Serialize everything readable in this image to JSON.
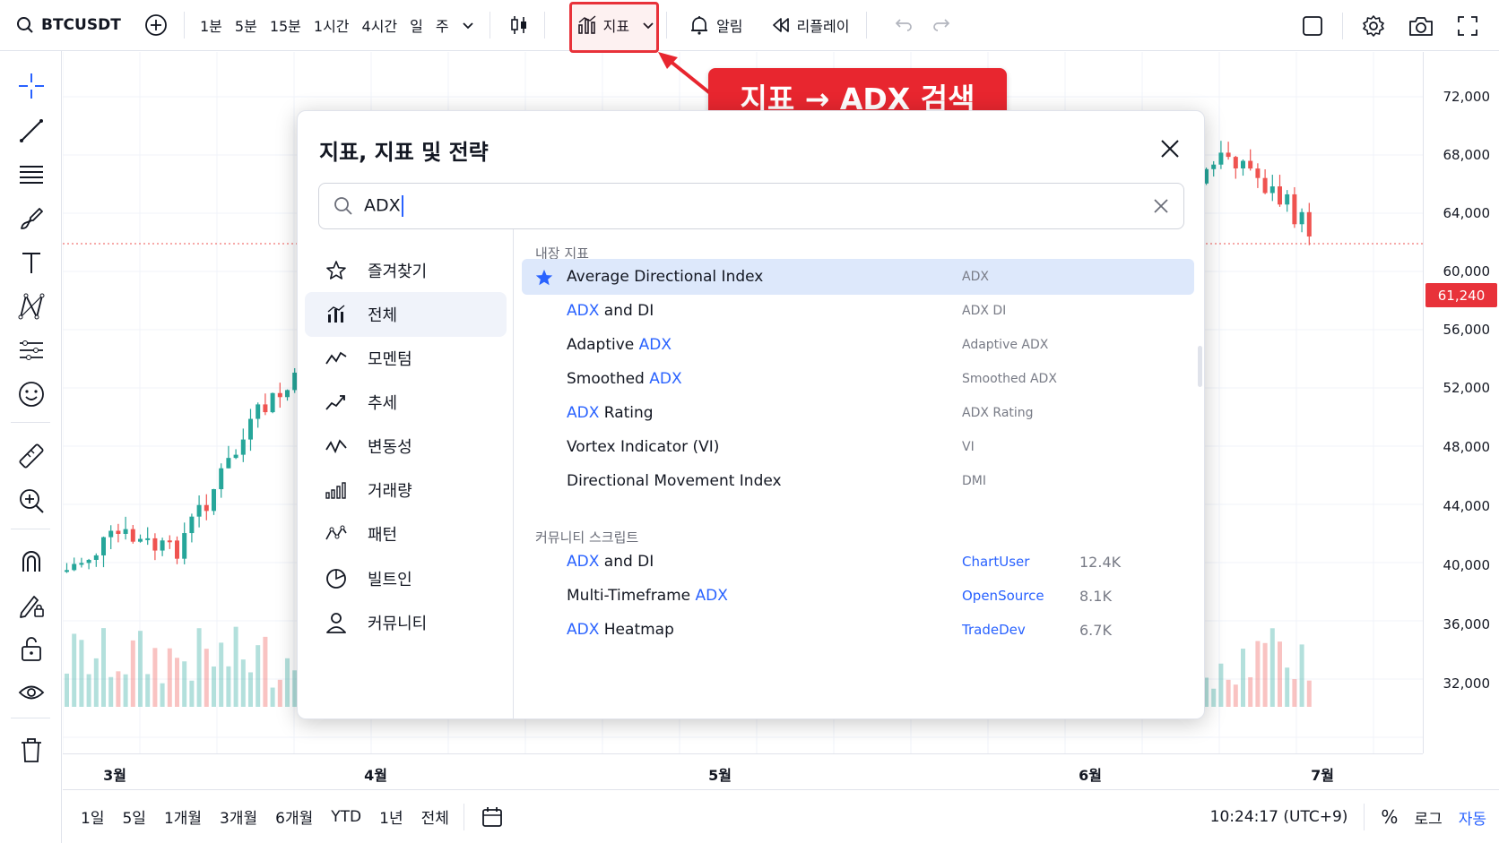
{
  "toolbar": {
    "symbol": "BTCUSDT",
    "timeframes": [
      "1분",
      "5분",
      "15분",
      "1시간",
      "4시간",
      "일",
      "주"
    ],
    "indicators_label": "지표",
    "alerts_label": "알림",
    "replay_label": "리플레이"
  },
  "annotation": {
    "callout_text": "지표 → ADX 검색",
    "accent_color": "#e8262f"
  },
  "price_axis": {
    "labels": [
      "72,000",
      "68,000",
      "64,000",
      "60,000",
      "56,000",
      "52,000",
      "48,000",
      "44,000",
      "40,000",
      "36,000",
      "32,000"
    ],
    "current_price": "61,240"
  },
  "time_axis": {
    "labels": [
      "3월",
      "4월",
      "5월",
      "6월",
      "7월"
    ]
  },
  "bottom_bar": {
    "ranges": [
      "1일",
      "5일",
      "1개월",
      "3개월",
      "6개월",
      "YTD",
      "1년",
      "전체"
    ],
    "clock": "10:24:17 (UTC+9)",
    "percent": "%",
    "log": "로그",
    "auto": "자동"
  },
  "modal": {
    "title": "지표, 지표 및 전략",
    "search_value": "ADX",
    "nav": [
      {
        "label": "즐겨찾기",
        "icon": "star-icon"
      },
      {
        "label": "전체",
        "icon": "bar-chart-icon"
      },
      {
        "label": "모멘텀",
        "icon": "momentum-icon"
      },
      {
        "label": "추세",
        "icon": "trend-icon"
      },
      {
        "label": "변동성",
        "icon": "volatility-icon"
      },
      {
        "label": "거래량",
        "icon": "volume-icon"
      },
      {
        "label": "패턴",
        "icon": "pattern-icon"
      },
      {
        "label": "빌트인",
        "icon": "builtin-icon"
      },
      {
        "label": "커뮤니티",
        "icon": "user-icon"
      }
    ],
    "builtin_header": "내장 지표",
    "builtin": [
      {
        "pre": "Average Directional Index",
        "hl": "",
        "post": "",
        "short": "ADX"
      },
      {
        "pre": "",
        "hl": "ADX",
        "post": " and DI",
        "short": "ADX DI"
      },
      {
        "pre": "Adaptive ",
        "hl": "ADX",
        "post": "",
        "short": "Adaptive ADX"
      },
      {
        "pre": "Smoothed ",
        "hl": "ADX",
        "post": "",
        "short": "Smoothed ADX"
      },
      {
        "pre": "",
        "hl": "ADX",
        "post": " Rating",
        "short": "ADX Rating"
      },
      {
        "pre": "Vortex Indicator (VI)",
        "hl": "",
        "post": "",
        "short": "VI"
      },
      {
        "pre": "Directional Movement Index",
        "hl": "",
        "post": "",
        "short": "DMI"
      }
    ],
    "community_header": "커뮤니티 스크립트",
    "community": [
      {
        "pre": "",
        "hl": "ADX",
        "post": " and DI",
        "author": "ChartUser",
        "count": "12.4K"
      },
      {
        "pre": "Multi-Timeframe ",
        "hl": "ADX",
        "post": "",
        "author": "OpenSource",
        "count": "8.1K"
      },
      {
        "pre": "",
        "hl": "ADX",
        "post": " Heatmap",
        "author": "TradeDev",
        "count": "6.7K"
      }
    ]
  },
  "colors": {
    "up": "#26a69a",
    "down": "#ef5350",
    "accent": "#2962ff"
  }
}
